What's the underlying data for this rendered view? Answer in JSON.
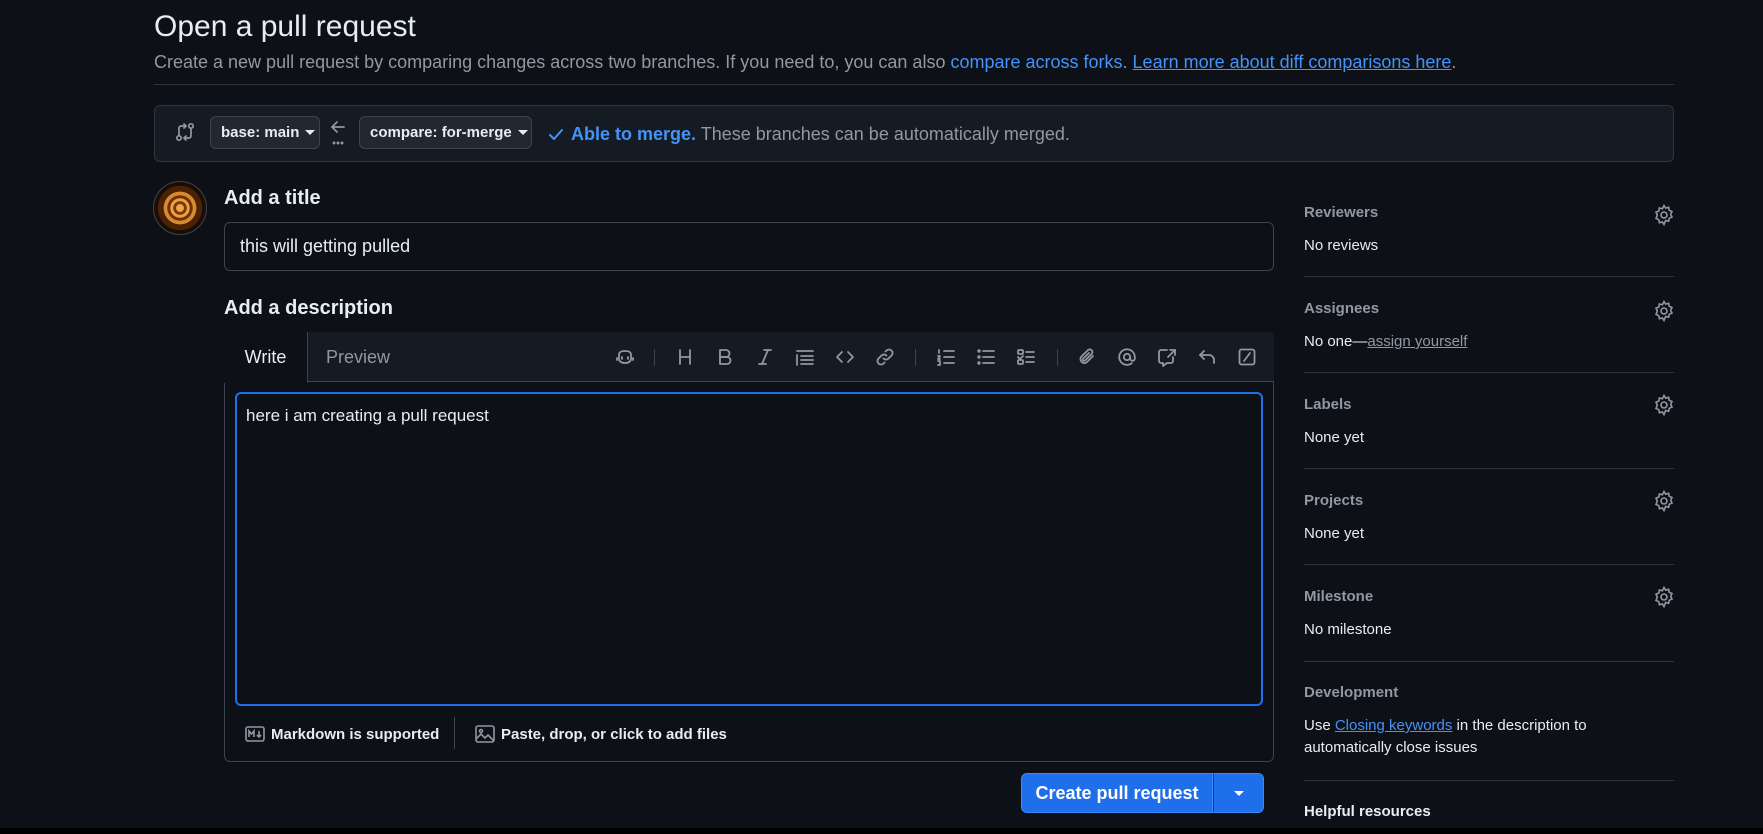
{
  "header": {
    "title": "Open a pull request",
    "subtitle_text": "Create a new pull request by comparing changes across two branches. If you need to, you can also ",
    "compare_forks_link": "compare across forks",
    "subtitle_mid": ". ",
    "learn_more_link": "Learn more about diff comparisons here",
    "subtitle_end": "."
  },
  "compare": {
    "base_label": "base: main",
    "compare_label": "compare: for-merge",
    "merge_status": "Able to merge.",
    "merge_detail": " These branches can be automatically merged."
  },
  "form": {
    "title_heading": "Add a title",
    "title_value": "this will getting pulled",
    "description_heading": "Add a description",
    "tabs": [
      {
        "label": "Write",
        "active": true
      },
      {
        "label": "Preview",
        "active": false
      }
    ],
    "toolbar_icons": [
      "copilot-icon",
      "heading-icon",
      "bold-icon",
      "italic-icon",
      "quote-icon",
      "code-icon",
      "link-icon",
      "numbered-list-icon",
      "unordered-list-icon",
      "task-list-icon",
      "attach-icon",
      "mention-icon",
      "reference-icon",
      "undo-icon",
      "slash-command-icon"
    ],
    "description_value": "here i am creating a pull request",
    "markdown_note": "Markdown is supported",
    "attach_note": "Paste, drop, or click to add files",
    "submit_label": "Create pull request"
  },
  "sidebar": {
    "reviewers": {
      "heading": "Reviewers",
      "value": "No reviews"
    },
    "assignees": {
      "heading": "Assignees",
      "value_prefix": "No one—",
      "value_link": "assign yourself"
    },
    "labels": {
      "heading": "Labels",
      "value": "None yet"
    },
    "projects": {
      "heading": "Projects",
      "value": "None yet"
    },
    "milestone": {
      "heading": "Milestone",
      "value": "No milestone"
    },
    "development": {
      "heading": "Development",
      "text_prefix": "Use ",
      "link": "Closing keywords",
      "text_suffix": " in the description to",
      "text_line2": "automatically close issues"
    },
    "helpful_resources": "Helpful resources"
  },
  "colors": {
    "background": "#0d1117",
    "accent": "#1f6feb",
    "link": "#4493f8",
    "border": "#3d444d"
  }
}
